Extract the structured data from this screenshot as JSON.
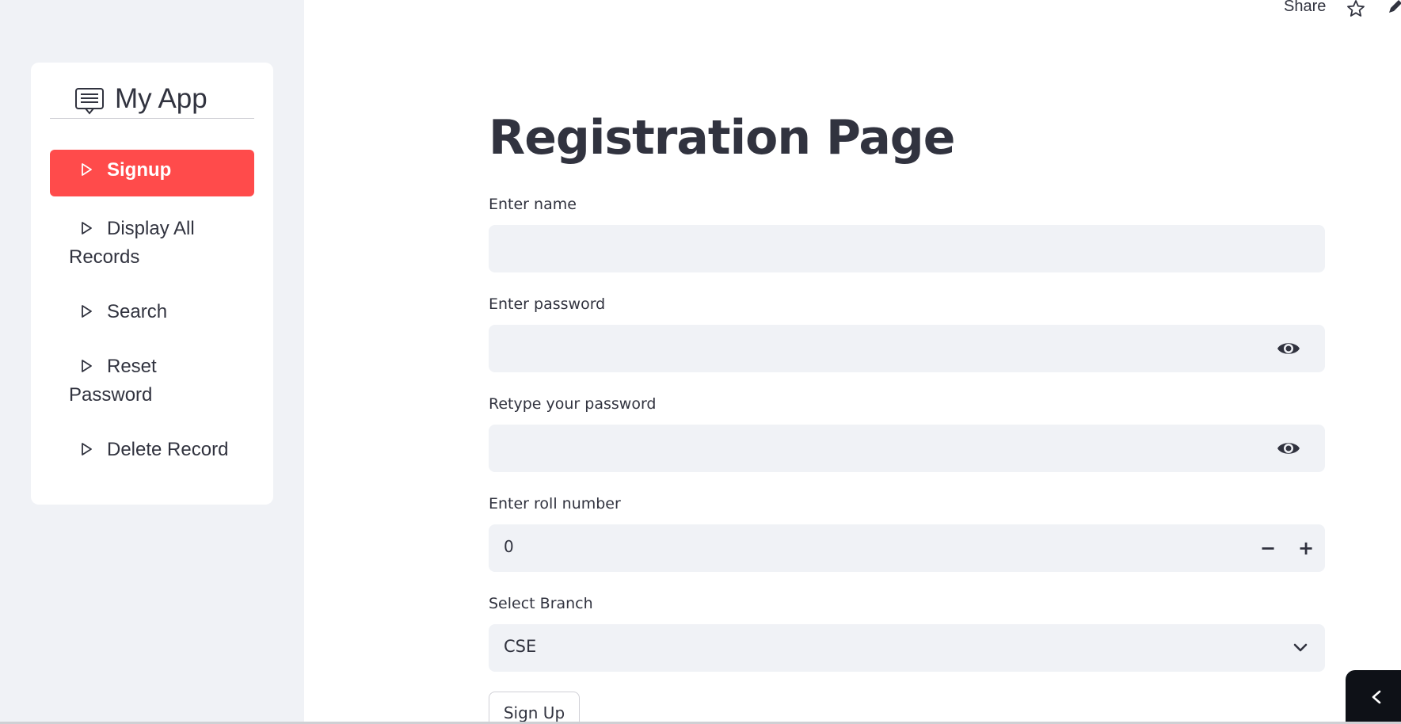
{
  "toolbar": {
    "share_label": "Share",
    "star_icon": "star-icon",
    "edit_icon": "pencil-icon"
  },
  "sidebar": {
    "app_title": "My App",
    "logo_icon": "chat-list-icon",
    "items": [
      {
        "label": "Signup",
        "active": true
      },
      {
        "label": "Display All Records",
        "active": false
      },
      {
        "label": "Search",
        "active": false
      },
      {
        "label": "Reset Password",
        "active": false
      },
      {
        "label": "Delete Record",
        "active": false
      }
    ],
    "accent_color": "#ff4b4b"
  },
  "main": {
    "title": "Registration Page",
    "name_label": "Enter name",
    "name_value": "",
    "password_label": "Enter password",
    "password_value": "",
    "retype_label": "Retype your password",
    "retype_value": "",
    "roll_label": "Enter roll number",
    "roll_value": "0",
    "minus_label": "−",
    "plus_label": "+",
    "branch_label": "Select Branch",
    "branch_value": "CSE",
    "signup_button": "Sign Up"
  }
}
